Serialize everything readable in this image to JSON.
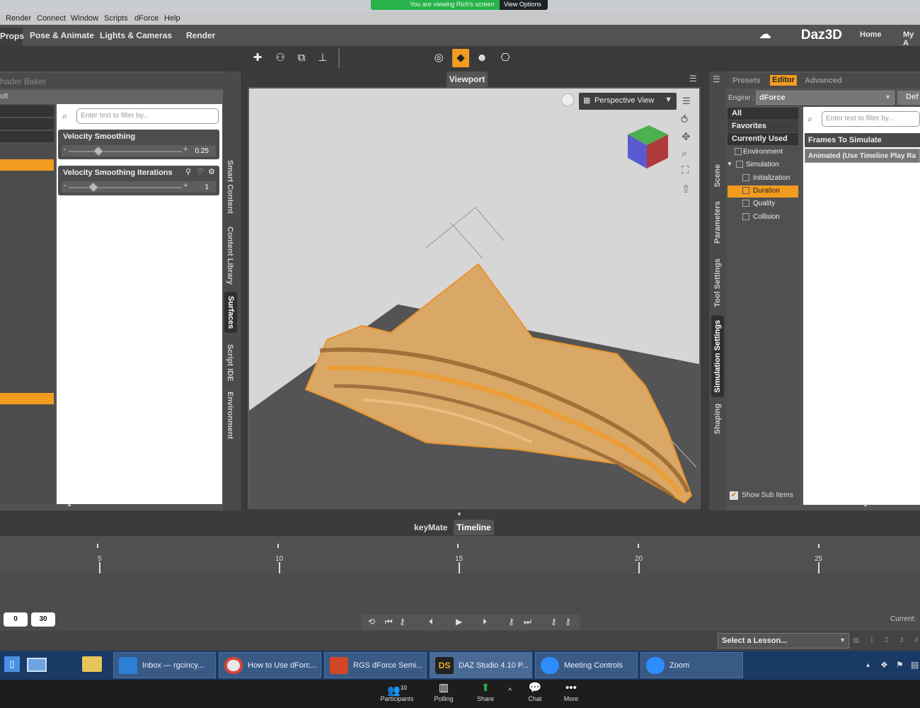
{
  "zoom": {
    "banner": "You are viewing Rich's screen",
    "view_options": "View Options ⌄"
  },
  "menu": [
    "Render",
    "Connect",
    "Window",
    "Scripts",
    "dForce",
    "Help"
  ],
  "tabs": [
    "Props",
    "Pose & Animate",
    "Lights & Cameras",
    "Render"
  ],
  "brand": {
    "logo": "Daz3D",
    "home": "Home",
    "my_account": "My A"
  },
  "left_panel": {
    "title": "hader Baker",
    "subtitle": "ult",
    "filter_placeholder": "Enter text to filter by...",
    "properties": [
      {
        "name": "Velocity Smoothing",
        "value": "0.25"
      },
      {
        "name": "Velocity Smoothing Iterations",
        "value": "1"
      }
    ],
    "side_tabs": [
      "Smart Content",
      "Content Library",
      "Surfaces",
      "Script IDE",
      "Environment"
    ]
  },
  "viewport": {
    "title": "Viewport",
    "view_mode": "Perspective View"
  },
  "right_panel": {
    "tabs": [
      "Presets",
      "Editor",
      "Advanced"
    ],
    "engine_label": "Engine :",
    "engine_value": "dForce",
    "default_btn": "Def",
    "filter_placeholder": "Enter text to filter by...",
    "tree": [
      "All",
      "Favorites",
      "Currently Used",
      "Environment",
      "Simulation",
      "Initialization",
      "Duration",
      "Quality",
      "Collision"
    ],
    "show_sub_items": "Show Sub Items",
    "property_header": "Frames To Simulate",
    "property_value": "Animated (Use Timeline Play Ra",
    "side_tabs": [
      "Scene",
      "Parameters",
      "Tool Settings",
      "Simulation Settings",
      "Shaping"
    ]
  },
  "timeline": {
    "tabs": [
      "keyMate",
      "Timeline"
    ],
    "ticks": [
      "5",
      "10",
      "15",
      "20",
      "25"
    ],
    "start": "0",
    "end": "30",
    "current_label": "Current:",
    "lesson": "Select a Lesson...",
    "pages": [
      "1",
      "2",
      "3",
      "4"
    ]
  },
  "taskbar": [
    {
      "label": "Inbox — rgcincy...",
      "color": "#2d7fd3"
    },
    {
      "label": "How to Use dForc...",
      "color": "#e8e8e8"
    },
    {
      "label": "RGS dForce Semi...",
      "color": "#d24726"
    },
    {
      "label": "DAZ Studio 4.10 P...",
      "color": "#222222"
    },
    {
      "label": "Meeting Controls",
      "color": "#2d8cff"
    },
    {
      "label": "Zoom",
      "color": "#2d8cff"
    }
  ],
  "zoom_controls": [
    {
      "label": "Participants",
      "icon": "participants-icon",
      "count": "10"
    },
    {
      "label": "Polling",
      "icon": "polling-icon"
    },
    {
      "label": "Share",
      "icon": "share-icon"
    },
    {
      "label": "Chat",
      "icon": "chat-icon"
    },
    {
      "label": "More",
      "icon": "more-icon"
    }
  ],
  "colors": {
    "accent": "#f29c1f",
    "zoom_green": "#28b24b",
    "taskbar": "#1a3a66"
  }
}
